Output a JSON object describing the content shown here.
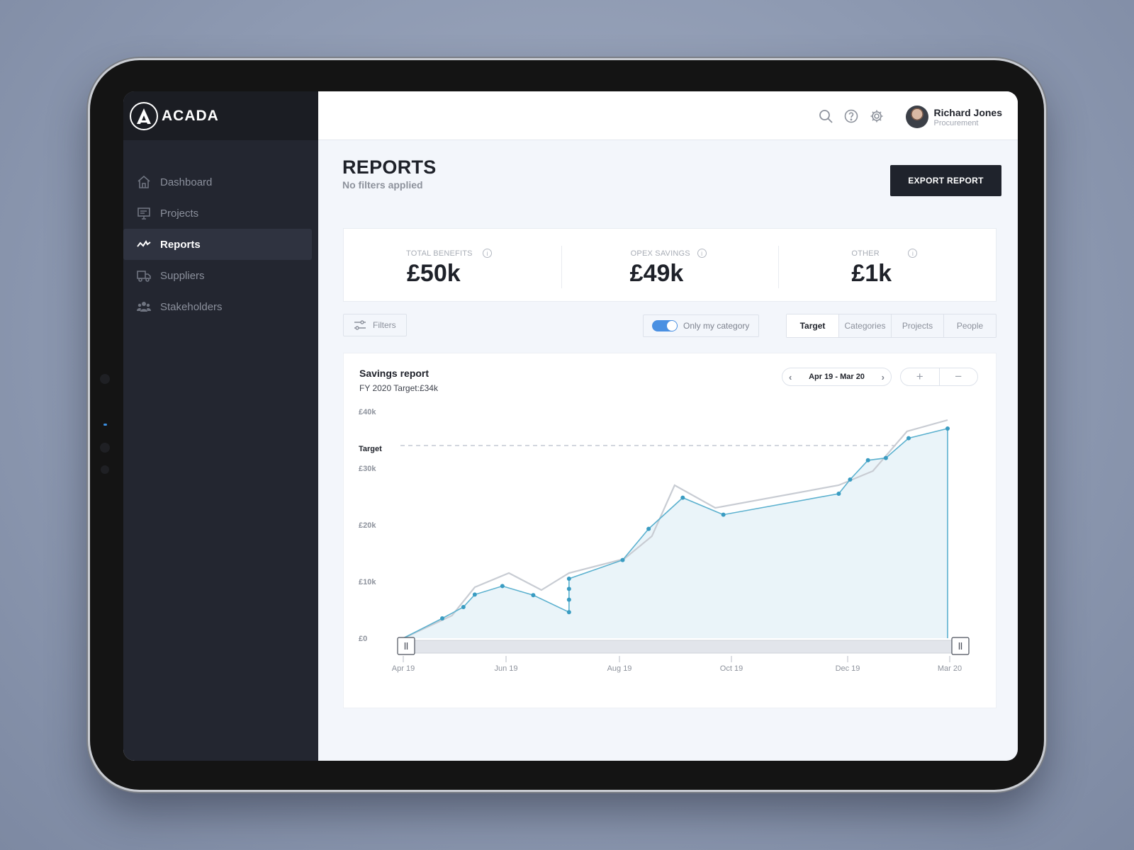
{
  "brand": {
    "name": "ACADA",
    "logo_letter": "A"
  },
  "sidebar": {
    "items": [
      {
        "label": "Dashboard",
        "icon": "home-icon",
        "active": false
      },
      {
        "label": "Projects",
        "icon": "projects-icon",
        "active": false
      },
      {
        "label": "Reports",
        "icon": "reports-icon",
        "active": true
      },
      {
        "label": "Suppliers",
        "icon": "truck-icon",
        "active": false
      },
      {
        "label": "Stakeholders",
        "icon": "people-icon",
        "active": false
      }
    ]
  },
  "header": {
    "icons": [
      "search-icon",
      "help-icon",
      "gear-icon"
    ],
    "user": {
      "name": "Richard Jones",
      "role": "Procurement"
    }
  },
  "page": {
    "title": "REPORTS",
    "subtitle": "No filters applied",
    "export_label": "EXPORT REPORT"
  },
  "kpis": [
    {
      "label": "TOTAL BENEFITS",
      "value": "£50k"
    },
    {
      "label": "OPEX SAVINGS",
      "value": "£49k"
    },
    {
      "label": "OTHER",
      "value": "£1k"
    }
  ],
  "controls": {
    "filters_label": "Filters",
    "toggle_label": "Only my category",
    "toggle_on": true,
    "tabs": [
      {
        "label": "Target",
        "active": true
      },
      {
        "label": "Categories",
        "active": false
      },
      {
        "label": "Projects",
        "active": false
      },
      {
        "label": "People",
        "active": false
      }
    ]
  },
  "report": {
    "title": "Savings report",
    "subtitle": "FY 2020 Target:£34k",
    "range_label": "Apr 19 - Mar 20",
    "zoom_in": "+",
    "zoom_out": "−"
  },
  "colors": {
    "accent": "#4a90e2",
    "actual_line": "#5cb1cf",
    "comparison_line": "#c8ccd3",
    "target_line": "#c3c8d3",
    "area_fill": "#eaf4f9"
  },
  "chart_data": {
    "type": "line",
    "x_ticks": [
      "Apr 19",
      "Jun 19",
      "Aug 19",
      "Oct 19",
      "Dec 19",
      "Mar 20"
    ],
    "y_ticks": [
      {
        "value": 0,
        "label": "£0"
      },
      {
        "value": 10000,
        "label": "£10k"
      },
      {
        "value": 20000,
        "label": "£20k"
      },
      {
        "value": 30000,
        "label": "£30k"
      },
      {
        "value": 40000,
        "label": "£40k"
      }
    ],
    "ylim": [
      0,
      40000
    ],
    "target": {
      "label": "Target",
      "value": 34000
    },
    "series": [
      {
        "kind": "actual",
        "markers": true,
        "x": [
          "2019-04-01",
          "2019-04-25",
          "2019-05-08",
          "2019-05-15",
          "2019-06-01",
          "2019-06-20",
          "2019-07-12",
          "2019-07-12",
          "2019-07-12",
          "2019-07-12",
          "2019-08-14",
          "2019-08-30",
          "2019-09-20",
          "2019-10-15",
          "2019-12-25",
          "2020-01-01",
          "2020-01-12",
          "2020-01-23",
          "2020-02-06",
          "2020-03-01",
          "2020-03-01"
        ],
        "y": [
          0,
          3500,
          5500,
          7700,
          9200,
          7600,
          4600,
          6800,
          8700,
          10500,
          13800,
          19300,
          24800,
          21800,
          25500,
          28000,
          31400,
          31800,
          35300,
          37000,
          0
        ]
      },
      {
        "kind": "comparison",
        "markers": false,
        "x": [
          "2019-04-01",
          "2019-05-01",
          "2019-05-15",
          "2019-06-05",
          "2019-06-25",
          "2019-07-12",
          "2019-08-15",
          "2019-09-01",
          "2019-09-15",
          "2019-10-10",
          "2019-12-25",
          "2020-01-15",
          "2020-02-05",
          "2020-03-01"
        ],
        "y": [
          0,
          4000,
          9000,
          11500,
          8500,
          11500,
          14000,
          18000,
          27000,
          23000,
          27000,
          29500,
          36500,
          38500
        ]
      }
    ]
  }
}
